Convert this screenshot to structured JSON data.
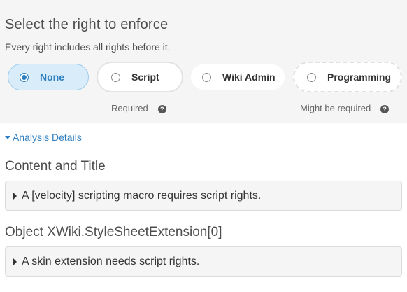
{
  "enforce": {
    "title": "Select the right to enforce",
    "subtitle": "Every right includes all rights before it.",
    "options": [
      {
        "label": "None",
        "selected": true
      },
      {
        "label": "Script",
        "selected": false
      },
      {
        "label": "Wiki Admin",
        "selected": false
      },
      {
        "label": "Programming",
        "selected": false
      }
    ],
    "hint_required": "Required",
    "hint_maybe": "Might be required",
    "help_glyph": "?"
  },
  "analysis": {
    "toggle_label": "Analysis Details",
    "sections": [
      {
        "heading": "Content and Title",
        "issue": "A [velocity] scripting macro requires script rights."
      },
      {
        "heading": "Object XWiki.StyleSheetExtension[0]",
        "issue": "A skin extension needs script rights."
      }
    ]
  },
  "colors": {
    "accent": "#2d7fbf",
    "selected_bg": "#d9ecf9",
    "panel_bg": "#f5f5f5"
  }
}
